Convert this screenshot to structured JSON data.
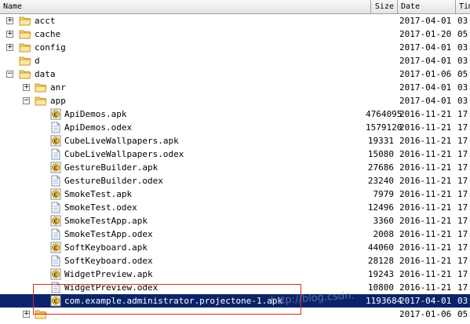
{
  "columns": {
    "name": "Name",
    "size": "Size",
    "date": "Date",
    "time": "Tim"
  },
  "watermark": "http://blog.csdn.",
  "rows": [
    {
      "name": "acct",
      "size": "",
      "date": "2017-04-01",
      "time": "03:",
      "type": "folder",
      "expander": "+",
      "indent": 0
    },
    {
      "name": "cache",
      "size": "",
      "date": "2017-01-20",
      "time": "05:",
      "type": "folder",
      "expander": "+",
      "indent": 0
    },
    {
      "name": "config",
      "size": "",
      "date": "2017-04-01",
      "time": "03:",
      "type": "folder",
      "expander": "+",
      "indent": 0
    },
    {
      "name": "d",
      "size": "",
      "date": "2017-04-01",
      "time": "03:",
      "type": "folder",
      "expander": "",
      "indent": 0
    },
    {
      "name": "data",
      "size": "",
      "date": "2017-01-06",
      "time": "05:",
      "type": "folder",
      "expander": "−",
      "indent": 0
    },
    {
      "name": "anr",
      "size": "",
      "date": "2017-04-01",
      "time": "03:",
      "type": "folder",
      "expander": "+",
      "indent": 1
    },
    {
      "name": "app",
      "size": "",
      "date": "2017-04-01",
      "time": "03:",
      "type": "folder",
      "expander": "−",
      "indent": 1
    },
    {
      "name": "ApiDemos.apk",
      "size": "4764095",
      "date": "2016-11-21",
      "time": "17:",
      "type": "apk",
      "expander": "",
      "indent": 2
    },
    {
      "name": "ApiDemos.odex",
      "size": "1579120",
      "date": "2016-11-21",
      "time": "17:",
      "type": "file",
      "expander": "",
      "indent": 2
    },
    {
      "name": "CubeLiveWallpapers.apk",
      "size": "19331",
      "date": "2016-11-21",
      "time": "17:",
      "type": "apk",
      "expander": "",
      "indent": 2
    },
    {
      "name": "CubeLiveWallpapers.odex",
      "size": "15080",
      "date": "2016-11-21",
      "time": "17:",
      "type": "file",
      "expander": "",
      "indent": 2
    },
    {
      "name": "GestureBuilder.apk",
      "size": "27686",
      "date": "2016-11-21",
      "time": "17:",
      "type": "apk",
      "expander": "",
      "indent": 2
    },
    {
      "name": "GestureBuilder.odex",
      "size": "23240",
      "date": "2016-11-21",
      "time": "17:",
      "type": "file",
      "expander": "",
      "indent": 2
    },
    {
      "name": "SmokeTest.apk",
      "size": "7979",
      "date": "2016-11-21",
      "time": "17:",
      "type": "apk",
      "expander": "",
      "indent": 2
    },
    {
      "name": "SmokeTest.odex",
      "size": "12496",
      "date": "2016-11-21",
      "time": "17:",
      "type": "file",
      "expander": "",
      "indent": 2
    },
    {
      "name": "SmokeTestApp.apk",
      "size": "3360",
      "date": "2016-11-21",
      "time": "17:",
      "type": "apk",
      "expander": "",
      "indent": 2
    },
    {
      "name": "SmokeTestApp.odex",
      "size": "2008",
      "date": "2016-11-21",
      "time": "17:",
      "type": "file",
      "expander": "",
      "indent": 2
    },
    {
      "name": "SoftKeyboard.apk",
      "size": "44060",
      "date": "2016-11-21",
      "time": "17:",
      "type": "apk",
      "expander": "",
      "indent": 2
    },
    {
      "name": "SoftKeyboard.odex",
      "size": "28128",
      "date": "2016-11-21",
      "time": "17:",
      "type": "file",
      "expander": "",
      "indent": 2
    },
    {
      "name": "WidgetPreview.apk",
      "size": "19243",
      "date": "2016-11-21",
      "time": "17:",
      "type": "apk",
      "expander": "",
      "indent": 2
    },
    {
      "name": "WidgetPreview.odex",
      "size": "10800",
      "date": "2016-11-21",
      "time": "17:",
      "type": "file",
      "expander": "",
      "indent": 2
    },
    {
      "name": "com.example.administrator.projectone-1.apk",
      "size": "1193684",
      "date": "2017-04-01",
      "time": "03:",
      "type": "apk",
      "expander": "",
      "indent": 2,
      "selected": true
    },
    {
      "name": "",
      "size": "",
      "date": "2017-01-06",
      "time": "05:",
      "type": "folder",
      "expander": "+",
      "indent": 1
    }
  ]
}
